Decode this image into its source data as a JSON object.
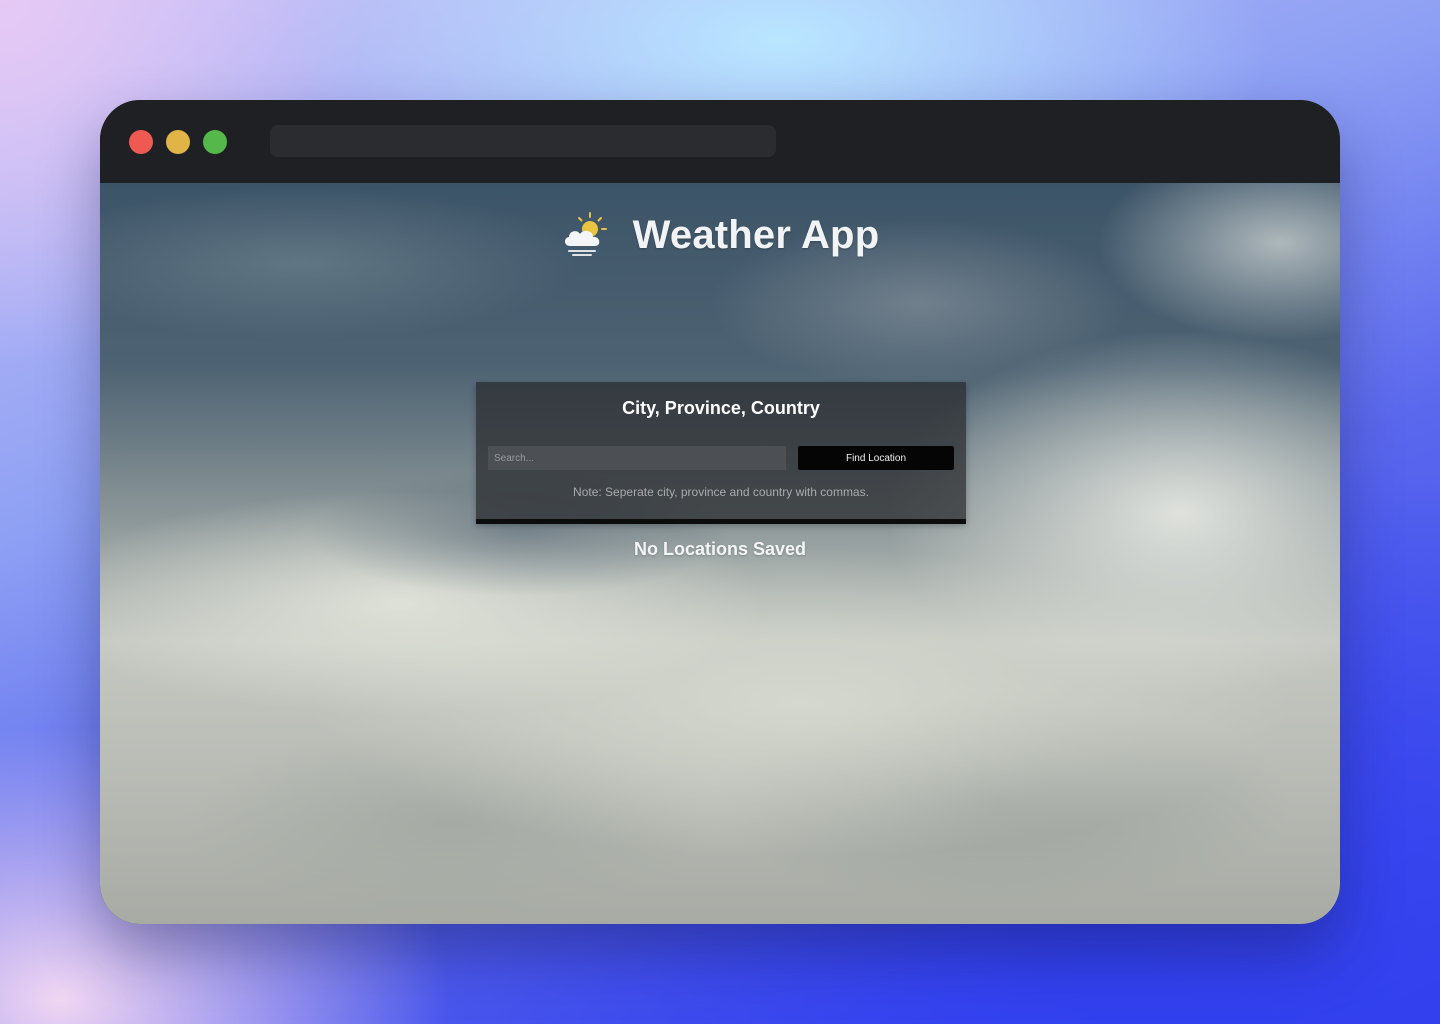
{
  "window": {
    "controls": {
      "close_icon": "traffic-light-close",
      "minimize_icon": "traffic-light-minimize",
      "maximize_icon": "traffic-light-maximize",
      "colors": {
        "close": "#ee5a52",
        "minimize": "#e0b446",
        "maximize": "#55b84a"
      }
    },
    "address_bar": {
      "value": ""
    }
  },
  "header": {
    "icon": "partly-cloudy-fog-icon",
    "title": "Weather App"
  },
  "search_card": {
    "title": "City, Province, Country",
    "input": {
      "value": "",
      "placeholder": "Search..."
    },
    "button_label": "Find Location",
    "note": "Note: Seperate city, province and country with commas."
  },
  "saved_locations": {
    "empty_message": "No Locations Saved"
  },
  "colors": {
    "button_bg": "#050505",
    "card_bg": "#28292d",
    "sun": "#e8c440"
  }
}
